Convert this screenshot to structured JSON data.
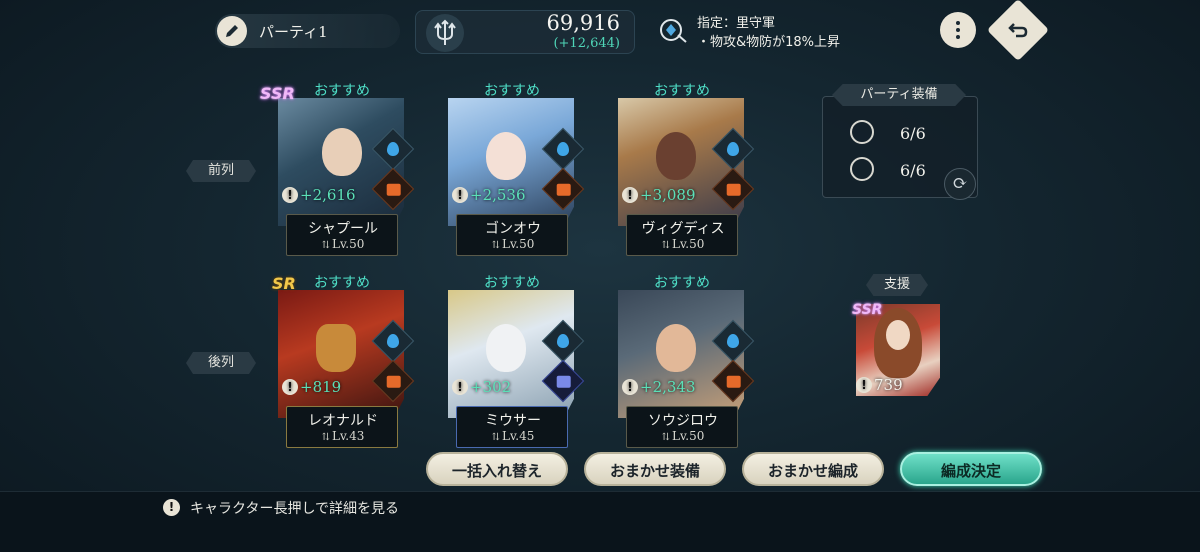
{
  "header": {
    "party_name": "パーティ1",
    "power": "69,916",
    "power_delta": "(+12,644)",
    "bonus_line1": "指定：里守軍",
    "bonus_line2": "・物攻&物防が18%上昇"
  },
  "row_labels": {
    "front": "前列",
    "back": "後列"
  },
  "recommend_label": "おすすめ",
  "characters": [
    {
      "name": "シャプール",
      "level": "Lv.50",
      "bonus": "+2,616",
      "rarity": "SSR",
      "element": "water-icon",
      "class": "fist-icon"
    },
    {
      "name": "ゴンオウ",
      "level": "Lv.50",
      "bonus": "+2,536",
      "rarity": "",
      "element": "water-icon",
      "class": "fist-icon"
    },
    {
      "name": "ヴィグディス",
      "level": "Lv.50",
      "bonus": "+3,089",
      "rarity": "",
      "element": "water-icon",
      "class": "fist-icon"
    },
    {
      "name": "レオナルド",
      "level": "Lv.43",
      "bonus": "+819",
      "rarity": "SR",
      "element": "water-icon",
      "class": "fist-icon"
    },
    {
      "name": "ミウサー",
      "level": "Lv.45",
      "bonus": "+302",
      "rarity": "",
      "element": "water-icon",
      "class": "support-icon"
    },
    {
      "name": "ソウジロウ",
      "level": "Lv.50",
      "bonus": "+2,343",
      "rarity": "",
      "element": "water-icon",
      "class": "fist-icon"
    }
  ],
  "party_equipment": {
    "title": "パーティ装備",
    "row1": "6/6",
    "row2": "6/6"
  },
  "support": {
    "label": "支援",
    "rarity": "SSR",
    "bonus": "739"
  },
  "buttons": {
    "bulk_swap": "一括入れ替え",
    "auto_equip": "おまかせ装備",
    "auto_form": "おまかせ編成",
    "confirm": "編成決定"
  },
  "hint": "キャラクター長押しで詳細を見る",
  "colors": {
    "accent_teal": "#4fe0c8",
    "background": "#142630"
  }
}
